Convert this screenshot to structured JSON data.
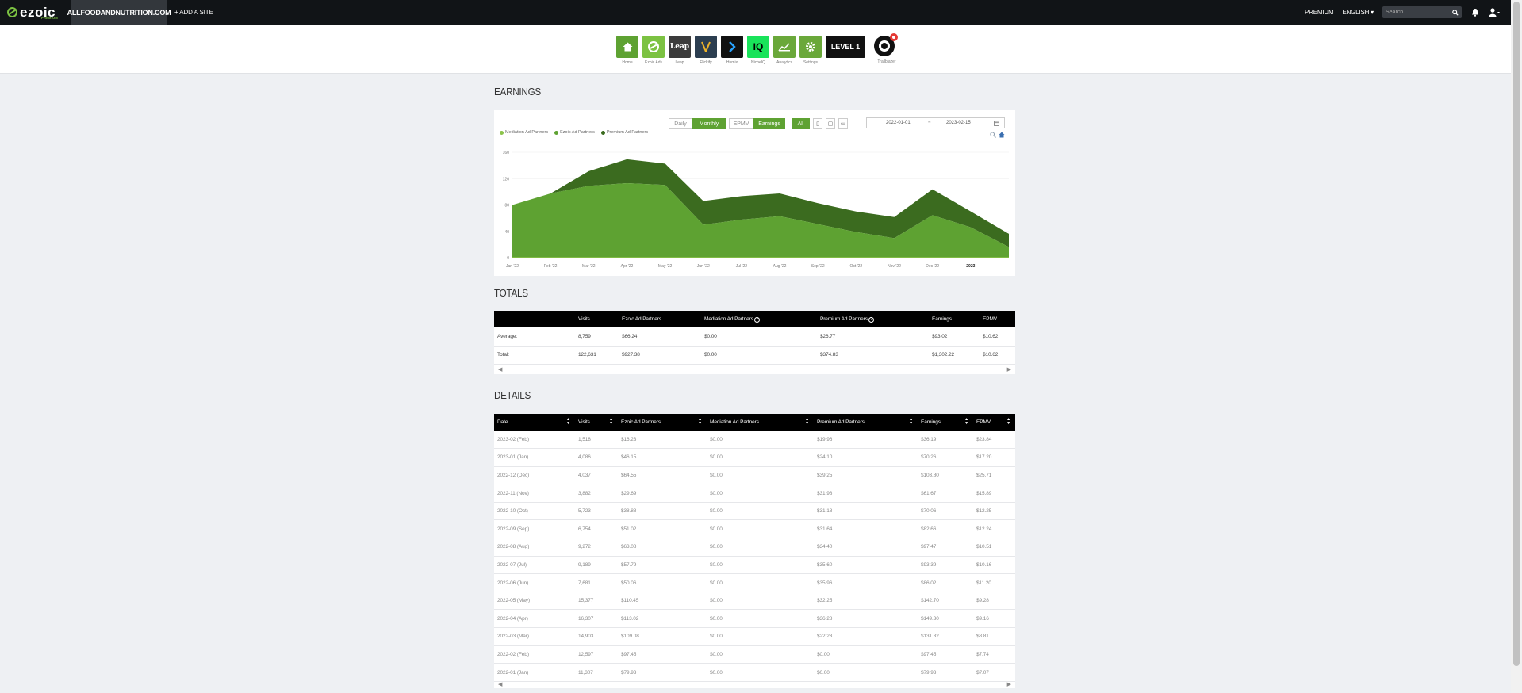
{
  "topbar": {
    "logo_text": "ezoic",
    "logo_sub": "PREMIUM",
    "site": "ALLFOODANDNUTRITION.COM",
    "add_site": "+ ADD A SITE",
    "premium": "PREMIUM",
    "language": "ENGLISH ▾",
    "search_placeholder": "Search..."
  },
  "apps": [
    {
      "label": "Home",
      "icon": "home-icon",
      "color": "#5ea232"
    },
    {
      "label": "Ezoic Ads",
      "icon": "ezoic-ads-icon",
      "color": "#7cc242"
    },
    {
      "label": "Leap",
      "icon": "leap-icon",
      "color": "#3b3b3b",
      "text": "Leap"
    },
    {
      "label": "Flickify",
      "icon": "flickify-icon",
      "color": "#2c3e50"
    },
    {
      "label": "Humix",
      "icon": "humix-icon",
      "color": "#111111"
    },
    {
      "label": "NicheIQ",
      "icon": "nicheiq-icon",
      "color": "#19e35a",
      "text": "IQ"
    },
    {
      "label": "Analytics",
      "icon": "analytics-icon",
      "color": "#6aa83a"
    },
    {
      "label": "Settings",
      "icon": "settings-icon",
      "color": "#6aa83a"
    },
    {
      "label": "",
      "icon": "level-icon",
      "color": "#111111",
      "text": "LEVEL 1"
    },
    {
      "label": "Trailblazer",
      "icon": "trailblazer-icon",
      "color": "#ffffff"
    }
  ],
  "earnings": {
    "title": "EARNINGS",
    "period_buttons": [
      "Daily",
      "Monthly"
    ],
    "metric_buttons": [
      "EPMV",
      "Earnings"
    ],
    "all_button": "All",
    "date_from": "2022-01-01",
    "date_sep": "~",
    "date_to": "2023-02-15"
  },
  "chart_data": {
    "type": "area",
    "legend": [
      "Mediation Ad Partners",
      "Ezoic Ad Partners",
      "Premium Ad Partners"
    ],
    "colors": {
      "mediation": "#8bc34a",
      "ezoic": "#5ea232",
      "premium": "#3b6b1f"
    },
    "x": [
      "Jan '22",
      "Feb '22",
      "Mar '22",
      "Apr '22",
      "May '22",
      "Jun '22",
      "Jul '22",
      "Aug '22",
      "Sep '22",
      "Oct '22",
      "Nov '22",
      "Dec '22",
      "2023"
    ],
    "yticks": [
      "0",
      "40",
      "80",
      "120",
      "160"
    ],
    "ylim": [
      0,
      160
    ],
    "series": [
      {
        "name": "Ezoic Ad Partners",
        "values": [
          79.93,
          97.45,
          109.08,
          113.02,
          110.45,
          50.06,
          57.79,
          63.08,
          51.02,
          38.88,
          29.69,
          64.55,
          46.15,
          16.23
        ]
      },
      {
        "name": "Premium Ad Partners",
        "values": [
          0,
          0,
          22.23,
          36.28,
          32.25,
          35.96,
          35.6,
          34.4,
          31.64,
          31.18,
          31.98,
          39.25,
          24.1,
          19.96
        ]
      },
      {
        "name": "Mediation Ad Partners",
        "values": [
          0,
          0,
          0,
          0,
          0,
          0,
          0,
          0,
          0,
          0,
          0,
          0,
          0,
          0
        ]
      }
    ]
  },
  "totals": {
    "title": "TOTALS",
    "headers": [
      "",
      "Visits",
      "Ezoic Ad Partners",
      "Mediation Ad Partners",
      "Premium Ad Partners",
      "Earnings",
      "EPMV"
    ],
    "rows": [
      [
        "Average:",
        "8,759",
        "$66.24",
        "$0.00",
        "$26.77",
        "$93.02",
        "$10.62"
      ],
      [
        "Total:",
        "122,631",
        "$927.38",
        "$0.00",
        "$374.83",
        "$1,302.22",
        "$10.62"
      ]
    ]
  },
  "details": {
    "title": "DETAILS",
    "headers": [
      "Date",
      "Visits",
      "Ezoic Ad Partners",
      "Mediation Ad Partners",
      "Premium Ad Partners",
      "Earnings",
      "EPMV"
    ],
    "rows": [
      [
        "2023-02 (Feb)",
        "1,518",
        "$16.23",
        "$0.00",
        "$19.96",
        "$36.19",
        "$23.84"
      ],
      [
        "2023-01 (Jan)",
        "4,086",
        "$46.15",
        "$0.00",
        "$24.10",
        "$70.26",
        "$17.20"
      ],
      [
        "2022-12 (Dec)",
        "4,037",
        "$64.55",
        "$0.00",
        "$39.25",
        "$103.80",
        "$25.71"
      ],
      [
        "2022-11 (Nov)",
        "3,882",
        "$29.69",
        "$0.00",
        "$31.98",
        "$61.67",
        "$15.89"
      ],
      [
        "2022-10 (Oct)",
        "5,723",
        "$38.88",
        "$0.00",
        "$31.18",
        "$70.06",
        "$12.25"
      ],
      [
        "2022-09 (Sep)",
        "6,754",
        "$51.02",
        "$0.00",
        "$31.64",
        "$82.66",
        "$12.24"
      ],
      [
        "2022-08 (Aug)",
        "9,272",
        "$63.08",
        "$0.00",
        "$34.40",
        "$97.47",
        "$10.51"
      ],
      [
        "2022-07 (Jul)",
        "9,189",
        "$57.79",
        "$0.00",
        "$35.60",
        "$93.39",
        "$10.16"
      ],
      [
        "2022-06 (Jun)",
        "7,681",
        "$50.06",
        "$0.00",
        "$35.96",
        "$86.02",
        "$11.20"
      ],
      [
        "2022-05 (May)",
        "15,377",
        "$110.45",
        "$0.00",
        "$32.25",
        "$142.70",
        "$9.28"
      ],
      [
        "2022-04 (Apr)",
        "16,307",
        "$113.02",
        "$0.00",
        "$36.28",
        "$149.30",
        "$9.16"
      ],
      [
        "2022-03 (Mar)",
        "14,903",
        "$109.08",
        "$0.00",
        "$22.23",
        "$131.32",
        "$8.81"
      ],
      [
        "2022-02 (Feb)",
        "12,597",
        "$97.45",
        "$0.00",
        "$0.00",
        "$97.45",
        "$7.74"
      ],
      [
        "2022-01 (Jan)",
        "11,307",
        "$79.93",
        "$0.00",
        "$0.00",
        "$79.93",
        "$7.07"
      ]
    ]
  }
}
